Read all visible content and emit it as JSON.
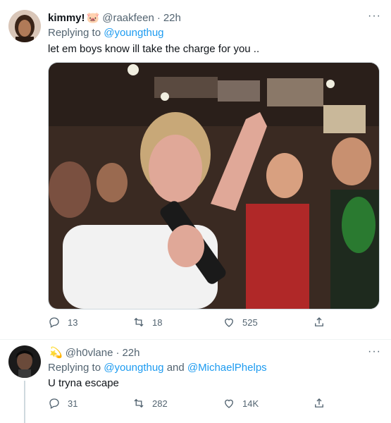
{
  "tweets": [
    {
      "name": "kimmy!",
      "name_emoji": "🐷",
      "handle": "@raakfeen",
      "time": "22h",
      "reply_prefix": "Replying to",
      "reply_to": [
        "@youngthug"
      ],
      "text": "let em boys know ill take the charge for you ..",
      "replies": "13",
      "retweets": "18",
      "likes": "525"
    },
    {
      "name_emoji": "💫",
      "handle": "@h0vlane",
      "time": "22h",
      "reply_prefix": "Replying to",
      "reply_to": [
        "@youngthug",
        "@MichaelPhelps"
      ],
      "reply_joiner": "and",
      "text": "U tryna escape",
      "replies": "31",
      "retweets": "282",
      "likes": "14K"
    }
  ],
  "more_glyph": "···",
  "dot": "·",
  "icons": [
    "reply-icon",
    "retweet-icon",
    "like-icon",
    "share-icon"
  ]
}
